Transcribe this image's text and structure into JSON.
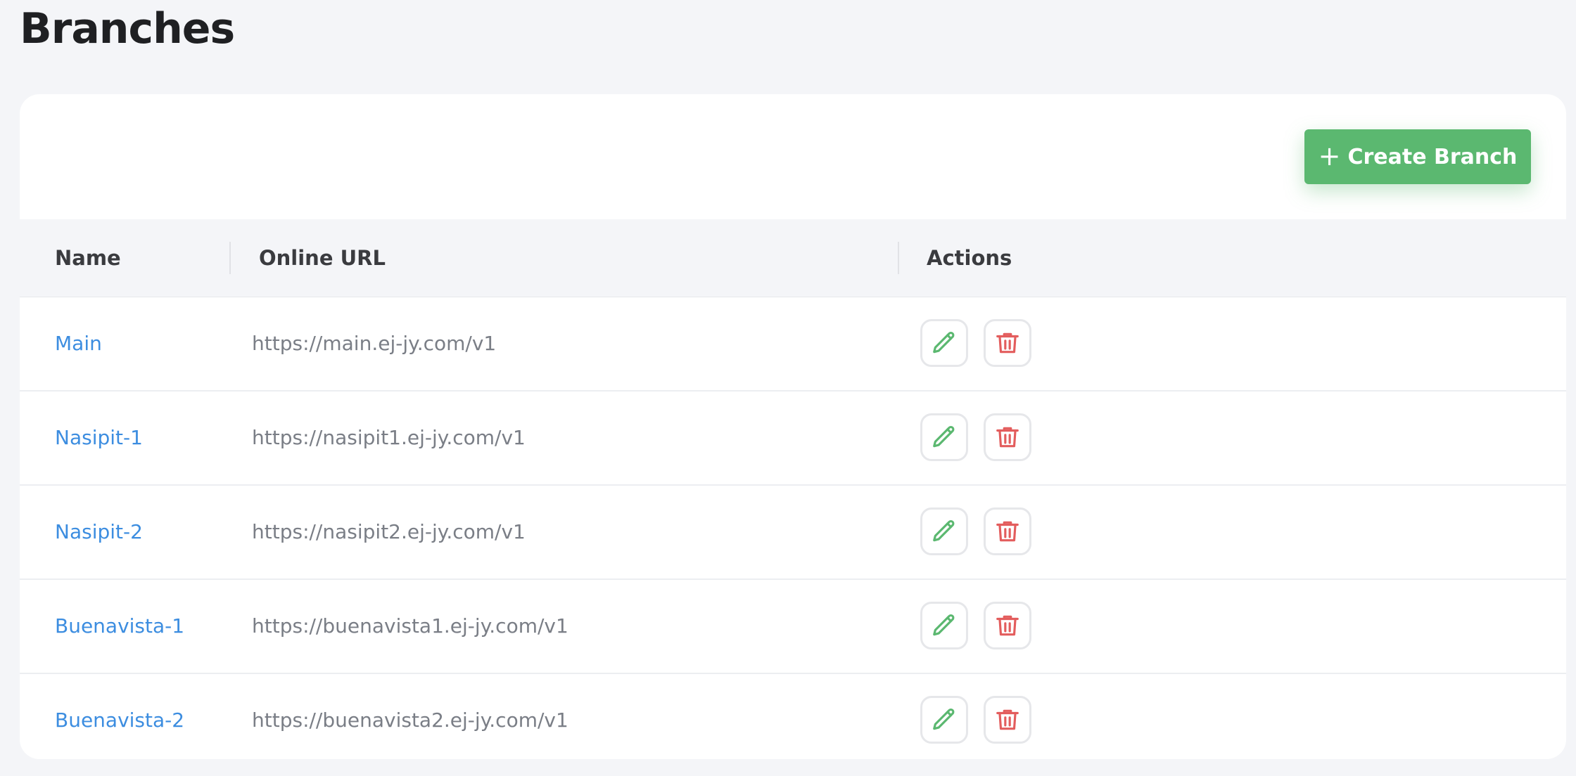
{
  "page": {
    "title": "Branches"
  },
  "toolbar": {
    "create_label": "Create Branch",
    "create_icon": "plus-icon"
  },
  "table": {
    "columns": [
      "Name",
      "Online URL",
      "Actions"
    ],
    "rows": [
      {
        "name": "Main",
        "url": "https://main.ej-jy.com/v1"
      },
      {
        "name": "Nasipit-1",
        "url": "https://nasipit1.ej-jy.com/v1"
      },
      {
        "name": "Nasipit-2",
        "url": "https://nasipit2.ej-jy.com/v1"
      },
      {
        "name": "Buenavista-1",
        "url": "https://buenavista1.ej-jy.com/v1"
      },
      {
        "name": "Buenavista-2",
        "url": "https://buenavista2.ej-jy.com/v1"
      }
    ],
    "row_actions": [
      "pencil-icon",
      "trash-icon"
    ]
  },
  "colors": {
    "accent_green": "#5bb870",
    "link_blue": "#3c8de0",
    "danger_red": "#e35d5d",
    "background": "#f4f5f8"
  }
}
